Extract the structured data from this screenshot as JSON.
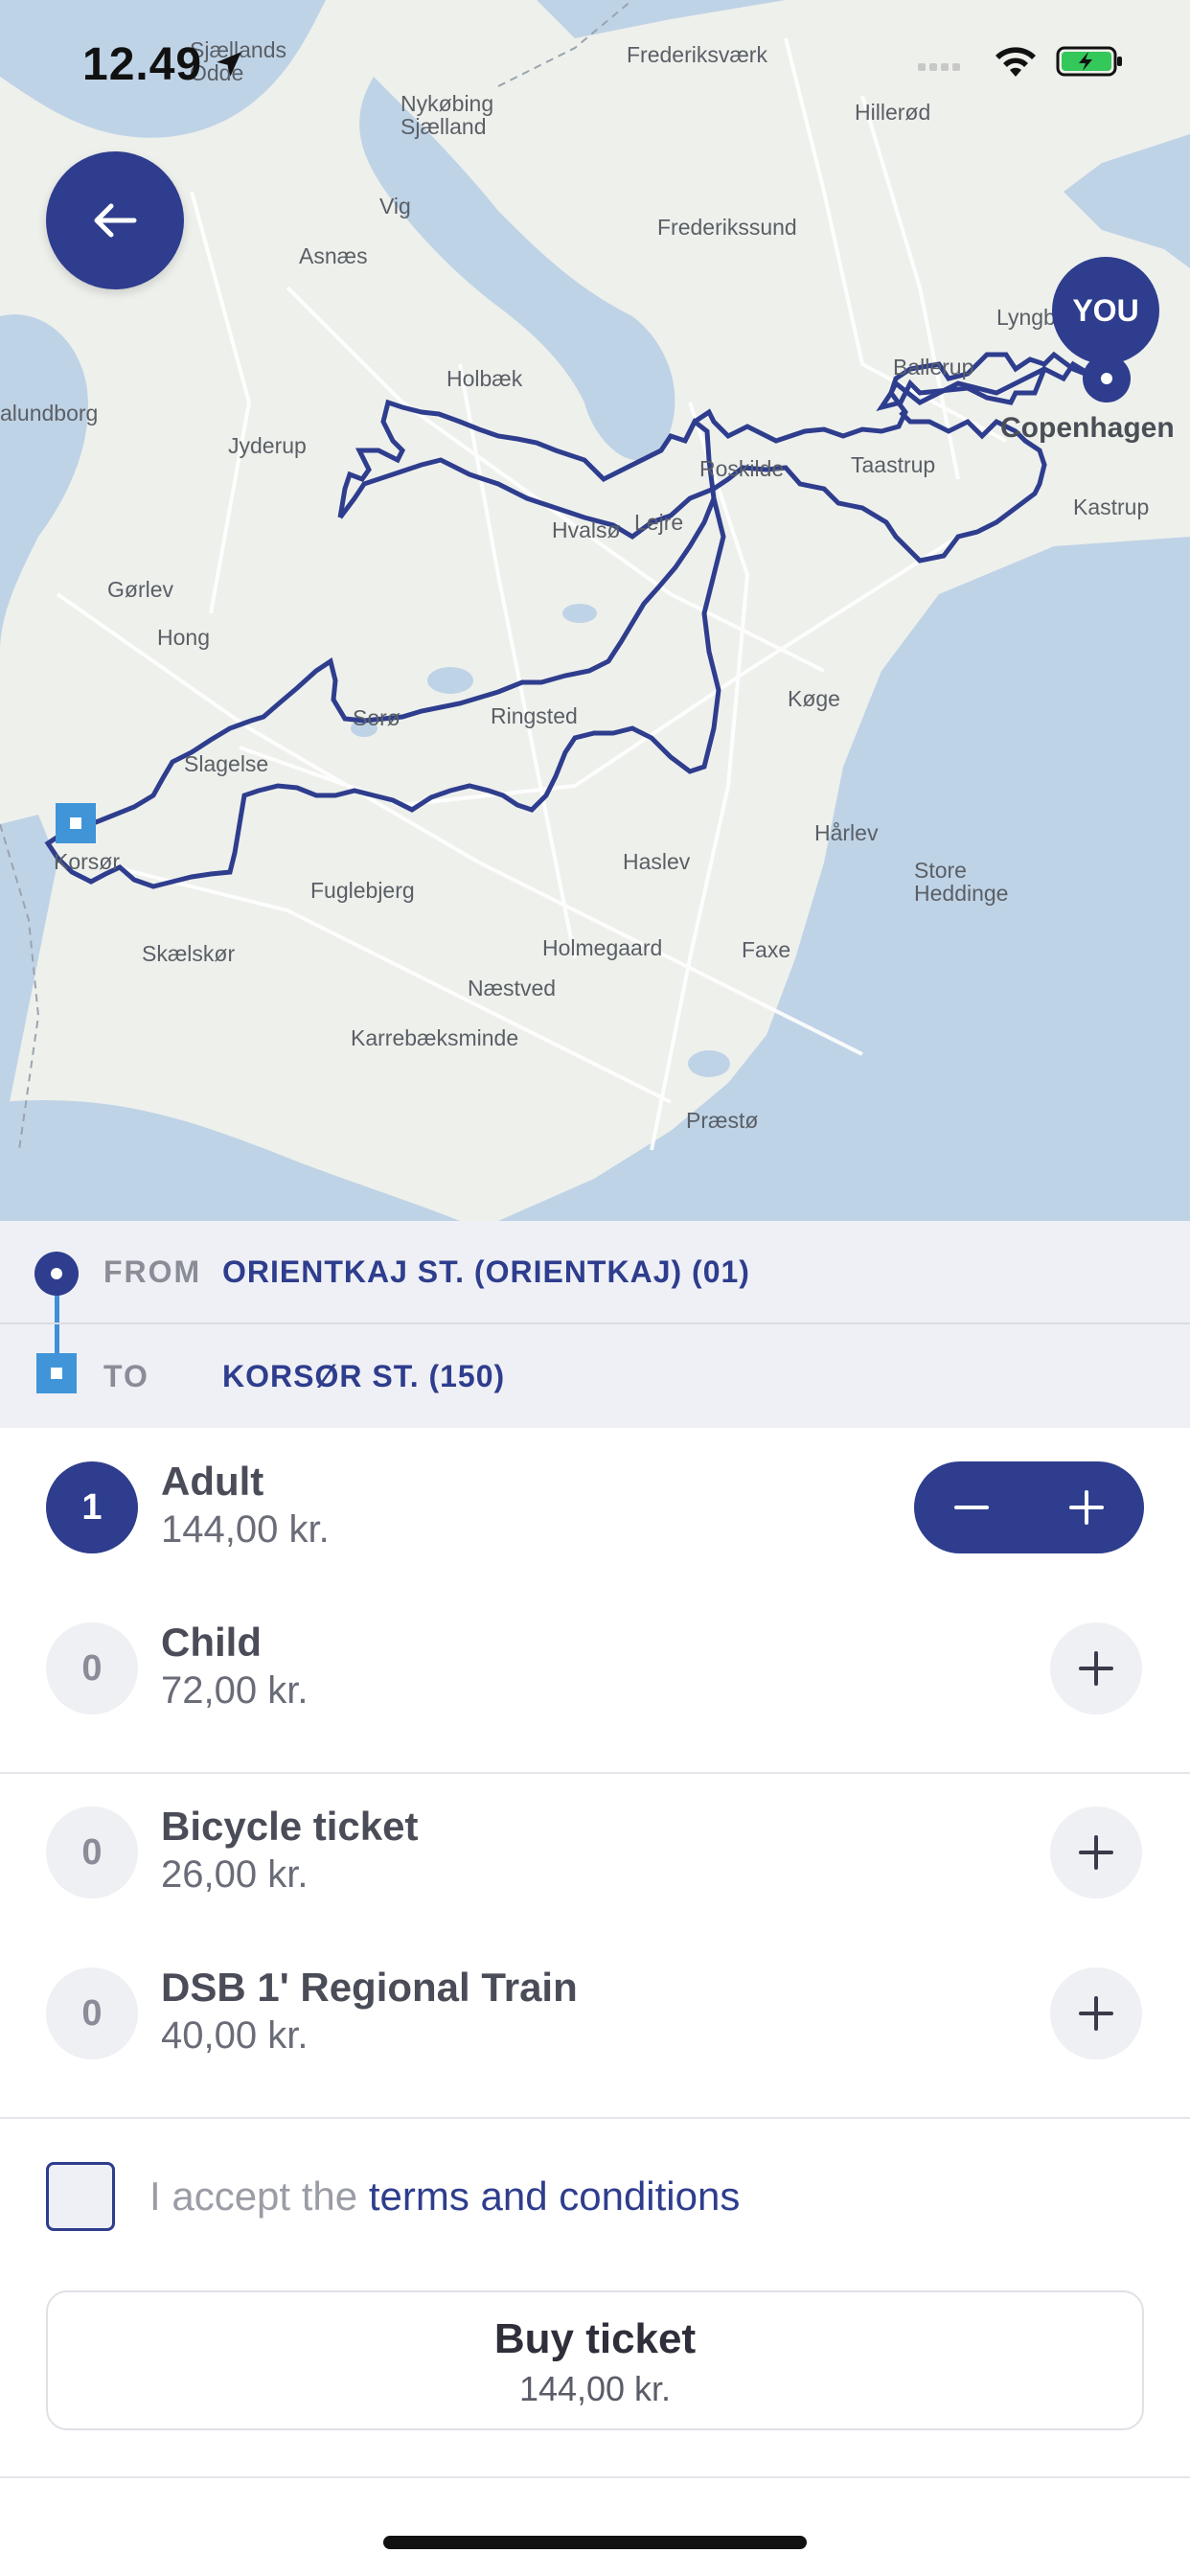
{
  "status_bar": {
    "time": "12.49",
    "icons": [
      "location-arrow-icon",
      "signal-icon",
      "wifi-icon",
      "battery-charging-icon"
    ],
    "battery_color": "#34c759"
  },
  "map": {
    "labels": {
      "frederiksvaerk": "Frederiksværk",
      "nykobing": "Nykøbing\nSjælland",
      "hillerod": "Hillerød",
      "sjaellands_odde": "Sjællands\nOdde",
      "vig": "Vig",
      "asnaes": "Asnæs",
      "frederikssund": "Frederikssund",
      "lyngby": "Lyngb",
      "holbaek": "Holbæk",
      "ballerup": "Ballerup",
      "kalundborg": "alundborg",
      "jyderup": "Jyderup",
      "roskilde": "Roskilde",
      "taastrup": "Taastrup",
      "copenhagen": "Copenhagen",
      "kastrup": "Kastrup",
      "hvalso": "Hvalsø",
      "lejre": "Lejre",
      "gorlev": "Gørlev",
      "hong": "Hong",
      "soro": "Sorø",
      "ringsted": "Ringsted",
      "koge": "Køge",
      "slagelse": "Slagelse",
      "korsor": "Korsør",
      "haslev": "Haslev",
      "harlev": "Hårlev",
      "store_heddinge": "Store\nHeddinge",
      "fuglebjerg": "Fuglebjerg",
      "skaelskor": "Skælskør",
      "holmegaard": "Holmegaard",
      "faxe": "Faxe",
      "naestved": "Næstved",
      "karrebaeksminde": "Karrebæksminde",
      "praesto": "Præstø"
    },
    "you_marker": "YOU",
    "route_color": "#2e3d8d",
    "land_color": "#eef0ec",
    "water_color": "#bfd3e6"
  },
  "route": {
    "from_key": "FROM",
    "from_value": "ORIENTKAJ ST. (ORIENTKAJ) (01)",
    "to_key": "TO",
    "to_value": "KORSØR ST. (150)"
  },
  "tickets": [
    {
      "qty": "1",
      "name": "Adult",
      "price": "144,00 kr."
    },
    {
      "qty": "0",
      "name": "Child",
      "price": "72,00 kr."
    },
    {
      "qty": "0",
      "name": "Bicycle ticket",
      "price": "26,00 kr."
    },
    {
      "qty": "0",
      "name": "DSB 1' Regional Train",
      "price": "40,00 kr."
    }
  ],
  "terms": {
    "prefix": "I accept the ",
    "link": "terms and conditions"
  },
  "buy": {
    "label": "Buy ticket",
    "price": "144,00 kr."
  },
  "colors": {
    "accent": "#2e3d8d",
    "to_marker": "#3f95d8"
  }
}
